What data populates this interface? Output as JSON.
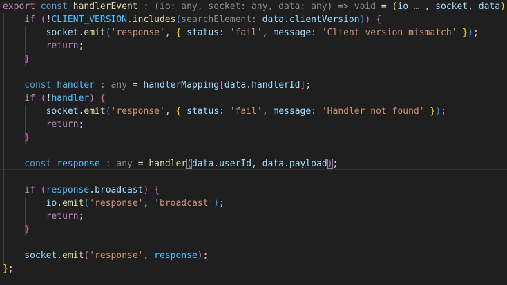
{
  "editor": {
    "lines": [
      [
        {
          "t": "export",
          "c": "ctl"
        },
        {
          "t": " "
        },
        {
          "t": "const",
          "c": "kw"
        },
        {
          "t": " "
        },
        {
          "t": "handlerEvent",
          "c": "fn"
        },
        {
          "t": " : (io: any, socket: any, data: any) => void ",
          "c": "hint"
        },
        {
          "t": "= "
        },
        {
          "t": "(",
          "c": "br1"
        },
        {
          "t": "io",
          "c": "vr"
        },
        {
          "t": " … ",
          "c": "hint"
        },
        {
          "t": ", "
        },
        {
          "t": "socket",
          "c": "vr"
        },
        {
          "t": ", "
        },
        {
          "t": "data",
          "c": "vr"
        },
        {
          "t": ")",
          "c": "br1"
        },
        {
          "t": " "
        },
        {
          "t": "=>",
          "c": "kw"
        }
      ],
      [
        {
          "t": "if",
          "c": "ctl"
        },
        {
          "t": " "
        },
        {
          "t": "(",
          "c": "br2"
        },
        {
          "t": "!"
        },
        {
          "t": "CLIENT_VERSION",
          "c": "cn"
        },
        {
          "t": "."
        },
        {
          "t": "includes",
          "c": "fn"
        },
        {
          "t": "(",
          "c": "br3"
        },
        {
          "t": "searchElement:",
          "c": "hint"
        },
        {
          "t": " "
        },
        {
          "t": "data",
          "c": "vr"
        },
        {
          "t": "."
        },
        {
          "t": "clientVersion",
          "c": "vr"
        },
        {
          "t": ")",
          "c": "br3"
        },
        {
          "t": ")",
          "c": "br2"
        },
        {
          "t": " "
        },
        {
          "t": "{",
          "c": "br2"
        }
      ],
      [
        {
          "t": "socket",
          "c": "vr"
        },
        {
          "t": "."
        },
        {
          "t": "emit",
          "c": "fn"
        },
        {
          "t": "(",
          "c": "br3"
        },
        {
          "t": "'response'",
          "c": "st"
        },
        {
          "t": ", "
        },
        {
          "t": "{",
          "c": "br1"
        },
        {
          "t": " "
        },
        {
          "t": "status",
          "c": "vr"
        },
        {
          "t": ": "
        },
        {
          "t": "'fail'",
          "c": "st"
        },
        {
          "t": ", "
        },
        {
          "t": "message",
          "c": "vr"
        },
        {
          "t": ": "
        },
        {
          "t": "'Client version mismatch'",
          "c": "st"
        },
        {
          "t": " "
        },
        {
          "t": "}",
          "c": "br1"
        },
        {
          "t": ")",
          "c": "br3"
        },
        {
          "t": ";"
        }
      ],
      [
        {
          "t": "return",
          "c": "ctl"
        },
        {
          "t": ";"
        }
      ],
      [
        {
          "t": "}",
          "c": "br2"
        }
      ],
      [],
      [
        {
          "t": "const",
          "c": "kw"
        },
        {
          "t": " "
        },
        {
          "t": "handler",
          "c": "cn"
        },
        {
          "t": " : any ",
          "c": "hint"
        },
        {
          "t": "= "
        },
        {
          "t": "handlerMapping",
          "c": "vr"
        },
        {
          "t": "[",
          "c": "br2"
        },
        {
          "t": "data",
          "c": "vr"
        },
        {
          "t": "."
        },
        {
          "t": "handlerId",
          "c": "vr"
        },
        {
          "t": "]",
          "c": "br2"
        },
        {
          "t": ";"
        }
      ],
      [
        {
          "t": "if",
          "c": "ctl"
        },
        {
          "t": " "
        },
        {
          "t": "(",
          "c": "br2"
        },
        {
          "t": "!"
        },
        {
          "t": "handler",
          "c": "cn"
        },
        {
          "t": ")",
          "c": "br2"
        },
        {
          "t": " "
        },
        {
          "t": "{",
          "c": "br2"
        }
      ],
      [
        {
          "t": "socket",
          "c": "vr"
        },
        {
          "t": "."
        },
        {
          "t": "emit",
          "c": "fn"
        },
        {
          "t": "(",
          "c": "br3"
        },
        {
          "t": "'response'",
          "c": "st"
        },
        {
          "t": ", "
        },
        {
          "t": "{",
          "c": "br1"
        },
        {
          "t": " "
        },
        {
          "t": "status",
          "c": "vr"
        },
        {
          "t": ": "
        },
        {
          "t": "'fail'",
          "c": "st"
        },
        {
          "t": ", "
        },
        {
          "t": "message",
          "c": "vr"
        },
        {
          "t": ": "
        },
        {
          "t": "'Handler not found'",
          "c": "st"
        },
        {
          "t": " "
        },
        {
          "t": "}",
          "c": "br1"
        },
        {
          "t": ")",
          "c": "br3"
        },
        {
          "t": ";"
        }
      ],
      [
        {
          "t": "return",
          "c": "ctl"
        },
        {
          "t": ";"
        }
      ],
      [
        {
          "t": "}",
          "c": "br2"
        }
      ],
      [],
      [
        {
          "t": "const",
          "c": "kw"
        },
        {
          "t": " "
        },
        {
          "t": "response",
          "c": "cn"
        },
        {
          "t": " : any ",
          "c": "hint"
        },
        {
          "t": "= "
        },
        {
          "t": "handler",
          "c": "fn"
        },
        {
          "t": "(",
          "c": "br2 cursorbox"
        },
        {
          "t": "data",
          "c": "vr"
        },
        {
          "t": "."
        },
        {
          "t": "userId",
          "c": "vr"
        },
        {
          "t": ", "
        },
        {
          "t": "data",
          "c": "vr"
        },
        {
          "t": "."
        },
        {
          "t": "payload",
          "c": "vr"
        },
        {
          "t": ")",
          "c": "br2 cursorbox"
        },
        {
          "t": ";"
        }
      ],
      [],
      [
        {
          "t": "if",
          "c": "ctl"
        },
        {
          "t": " "
        },
        {
          "t": "(",
          "c": "br2"
        },
        {
          "t": "response",
          "c": "cn"
        },
        {
          "t": "."
        },
        {
          "t": "broadcast",
          "c": "vr"
        },
        {
          "t": ")",
          "c": "br2"
        },
        {
          "t": " "
        },
        {
          "t": "{",
          "c": "br2"
        }
      ],
      [
        {
          "t": "io",
          "c": "vr"
        },
        {
          "t": "."
        },
        {
          "t": "emit",
          "c": "fn"
        },
        {
          "t": "(",
          "c": "br3"
        },
        {
          "t": "'response'",
          "c": "st"
        },
        {
          "t": ", "
        },
        {
          "t": "'broadcast'",
          "c": "st"
        },
        {
          "t": ")",
          "c": "br3"
        },
        {
          "t": ";"
        }
      ],
      [
        {
          "t": "return",
          "c": "ctl"
        },
        {
          "t": ";"
        }
      ],
      [
        {
          "t": "}",
          "c": "br2"
        }
      ],
      [],
      [
        {
          "t": "socket",
          "c": "vr"
        },
        {
          "t": "."
        },
        {
          "t": "emit",
          "c": "fn"
        },
        {
          "t": "(",
          "c": "br2"
        },
        {
          "t": "'response'",
          "c": "st"
        },
        {
          "t": ", "
        },
        {
          "t": "response",
          "c": "cn"
        },
        {
          "t": ")",
          "c": "br2"
        },
        {
          "t": ";"
        }
      ],
      [
        {
          "t": "}",
          "c": "br1"
        },
        {
          "t": ";"
        }
      ]
    ]
  }
}
